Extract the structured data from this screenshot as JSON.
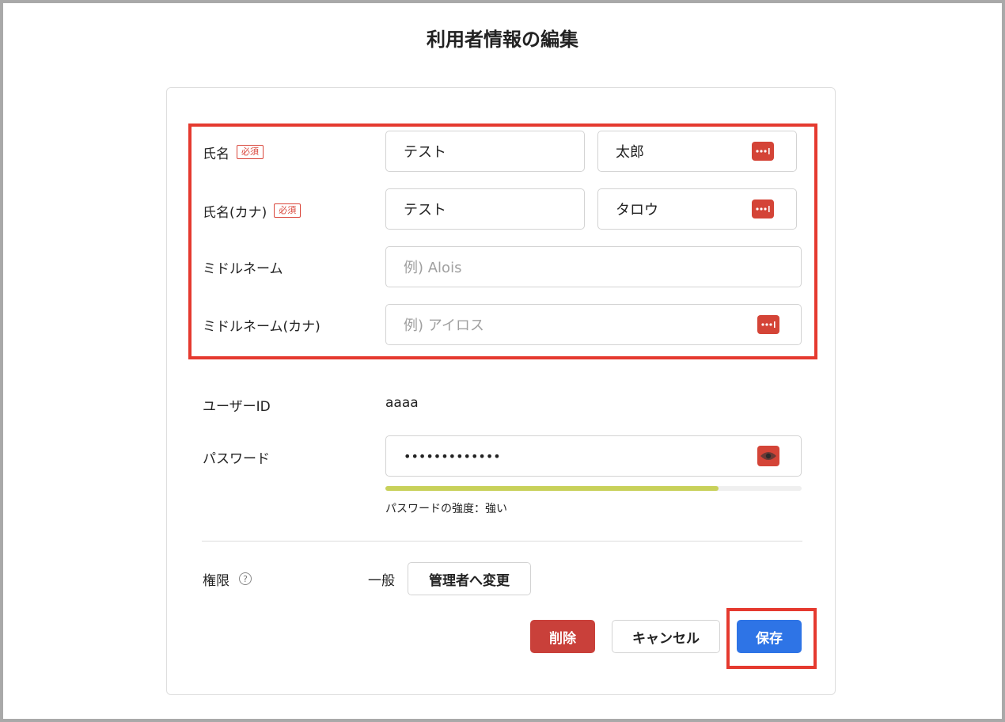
{
  "page": {
    "title": "利用者情報の編集"
  },
  "form": {
    "name": {
      "label": "氏名",
      "required_label": "必須",
      "last_value": "テスト",
      "first_value": "太郎"
    },
    "name_kana": {
      "label": "氏名(カナ)",
      "required_label": "必須",
      "last_value": "テスト",
      "first_value": "タロウ"
    },
    "middle_name": {
      "label": "ミドルネーム",
      "placeholder": "例) Alois"
    },
    "middle_name_kana": {
      "label": "ミドルネーム(カナ)",
      "placeholder": "例) アイロス"
    },
    "user_id": {
      "label": "ユーザーID",
      "value": "aaaa"
    },
    "password": {
      "label": "パスワード",
      "masked_value": "•••••••••••••",
      "strength_label": "パスワードの強度：強い",
      "strength_fraction": 0.8,
      "strength_color": "#c8d15a"
    },
    "role": {
      "label": "権限",
      "help_icon": "?",
      "value": "一般",
      "change_button": "管理者へ変更"
    }
  },
  "actions": {
    "delete": "削除",
    "cancel": "キャンセル",
    "save": "保存"
  },
  "colors": {
    "danger": "#c9403a",
    "primary": "#2e74e6",
    "highlight": "#e53a2f",
    "key_icon": "#d44437"
  },
  "icons": {
    "password_manager": "key-icon",
    "reveal_password": "eye-icon",
    "help": "question-circle-icon"
  }
}
